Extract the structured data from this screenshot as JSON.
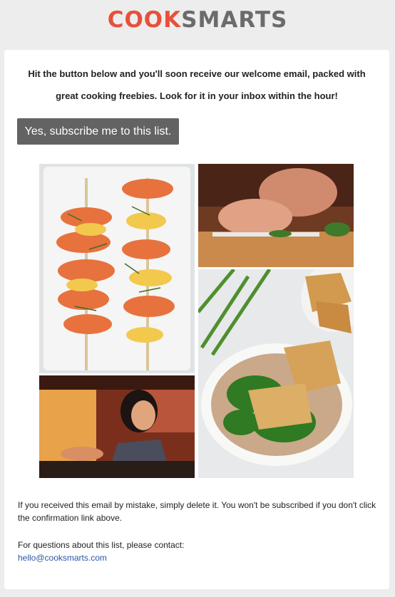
{
  "brand": {
    "cook": "COOK",
    "smarts": "SMARTS"
  },
  "intro_text": "Hit the button below and you'll soon receive our welcome email, packed with great cooking freebies. Look for it in your inbox within the hour!",
  "subscribe_button": "Yes, subscribe me to this list.",
  "mistake_note": "If you received this email by mistake, simply delete it. You won't be subscribed if you don't click the confirmation link above.",
  "contact": {
    "label": "For questions about this list, please contact:",
    "email": "hello@cooksmarts.com"
  },
  "colors": {
    "accent": "#e8503a",
    "brand_gray": "#6b6b6b",
    "button": "#636363",
    "link": "#2b57a7"
  }
}
